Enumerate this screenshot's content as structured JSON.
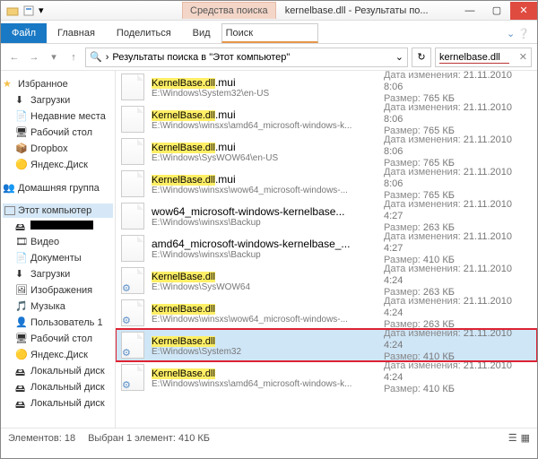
{
  "window": {
    "tools_tab": "Средства поиска",
    "title": "kernelbase.dll - Результаты по..."
  },
  "tabs": {
    "file": "Файл",
    "home": "Главная",
    "share": "Поделиться",
    "view": "Вид",
    "search": "Поиск"
  },
  "address": {
    "text": "Результаты поиска в \"Этот компьютер\""
  },
  "search": {
    "value": "kernelbase.dll"
  },
  "sidebar": {
    "fav": {
      "title": "Избранное",
      "items": [
        "Загрузки",
        "Недавние места",
        "Рабочий стол",
        "Dropbox",
        "Яндекс.Диск"
      ]
    },
    "home": {
      "title": "Домашняя группа"
    },
    "pc": {
      "title": "Этот компьютер",
      "items": [
        "",
        "Видео",
        "Документы",
        "Загрузки",
        "Изображения",
        "Музыка",
        "Пользователь 1",
        "Рабочий стол",
        "Яндекс.Диск",
        "Локальный диск",
        "Локальный диск",
        "Локальный диск"
      ]
    }
  },
  "meta_labels": {
    "date": "Дата изменения:",
    "size": "Размер:"
  },
  "files": [
    {
      "name_hl": "KernelBase.dll",
      "name_rest": ".mui",
      "path": "E:\\Windows\\System32\\en-US",
      "date": "21.11.2010 8:06",
      "size": "765 КБ",
      "gear": false
    },
    {
      "name_hl": "KernelBase.dll",
      "name_rest": ".mui",
      "path": "E:\\Windows\\winsxs\\amd64_microsoft-windows-k...",
      "date": "21.11.2010 8:06",
      "size": "765 КБ",
      "gear": false
    },
    {
      "name_hl": "KernelBase.dll",
      "name_rest": ".mui",
      "path": "E:\\Windows\\SysWOW64\\en-US",
      "date": "21.11.2010 8:06",
      "size": "765 КБ",
      "gear": false
    },
    {
      "name_hl": "KernelBase.dll",
      "name_rest": ".mui",
      "path": "E:\\Windows\\winsxs\\wow64_microsoft-windows-...",
      "date": "21.11.2010 8:06",
      "size": "765 КБ",
      "gear": false
    },
    {
      "name_hl": "",
      "name_rest": "wow64_microsoft-windows-kernelbase...",
      "path": "E:\\Windows\\winsxs\\Backup",
      "date": "21.11.2010 4:27",
      "size": "263 КБ",
      "gear": false
    },
    {
      "name_hl": "",
      "name_rest": "amd64_microsoft-windows-kernelbase_...",
      "path": "E:\\Windows\\winsxs\\Backup",
      "date": "21.11.2010 4:27",
      "size": "410 КБ",
      "gear": false
    },
    {
      "name_hl": "KernelBase.dll",
      "name_rest": "",
      "path": "E:\\Windows\\SysWOW64",
      "date": "21.11.2010 4:24",
      "size": "263 КБ",
      "gear": true
    },
    {
      "name_hl": "KernelBase.dll",
      "name_rest": "",
      "path": "E:\\Windows\\winsxs\\wow64_microsoft-windows-...",
      "date": "21.11.2010 4:24",
      "size": "263 КБ",
      "gear": true
    },
    {
      "name_hl": "KernelBase.dll",
      "name_rest": "",
      "path": "E:\\Windows\\System32",
      "date": "21.11.2010 4:24",
      "size": "410 КБ",
      "gear": true,
      "selected": true,
      "boxed": true
    },
    {
      "name_hl": "KernelBase.dll",
      "name_rest": "",
      "path": "E:\\Windows\\winsxs\\amd64_microsoft-windows-k...",
      "date": "21.11.2010 4:24",
      "size": "410 КБ",
      "gear": true
    }
  ],
  "status": {
    "count": "Элементов: 18",
    "selection": "Выбран 1 элемент: 410 КБ"
  }
}
